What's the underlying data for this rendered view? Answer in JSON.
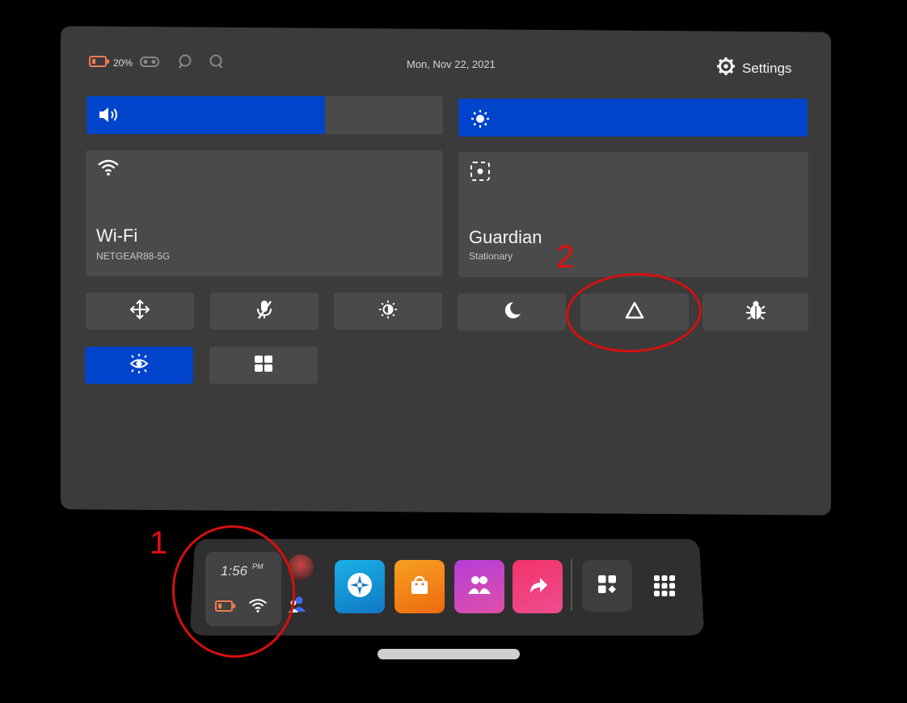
{
  "status": {
    "battery_percent": "20%",
    "date": "Mon, Nov 22, 2021",
    "settings_label": "Settings"
  },
  "sliders": {
    "volume_level": 0.67,
    "brightness_level": 1.0
  },
  "tiles": {
    "wifi": {
      "title": "Wi-Fi",
      "subtitle": "NETGEAR88-5G"
    },
    "guardian": {
      "title": "Guardian",
      "subtitle": "Stationary"
    }
  },
  "quick_buttons": [
    {
      "id": "recenter",
      "icon": "move-arrows-icon",
      "active": false
    },
    {
      "id": "mic",
      "icon": "mic-off-icon",
      "active": false
    },
    {
      "id": "brightness",
      "icon": "brightness-icon",
      "active": false
    },
    {
      "id": "night",
      "icon": "moon-icon",
      "active": false
    },
    {
      "id": "airlink",
      "icon": "airlink-icon",
      "active": false
    },
    {
      "id": "bug",
      "icon": "bug-icon",
      "active": false
    },
    {
      "id": "passthrough",
      "icon": "passthrough-eye-icon",
      "active": true
    },
    {
      "id": "apps",
      "icon": "grid-apps-icon",
      "active": false
    }
  ],
  "annotations": [
    {
      "label": "1"
    },
    {
      "label": "2"
    }
  ],
  "dock": {
    "time": "1:56",
    "ampm": "PM"
  },
  "colors": {
    "accent": "#0044cc",
    "battery": "#f07b50",
    "annotation": "#e01010",
    "panel": "#3b3b3b"
  }
}
